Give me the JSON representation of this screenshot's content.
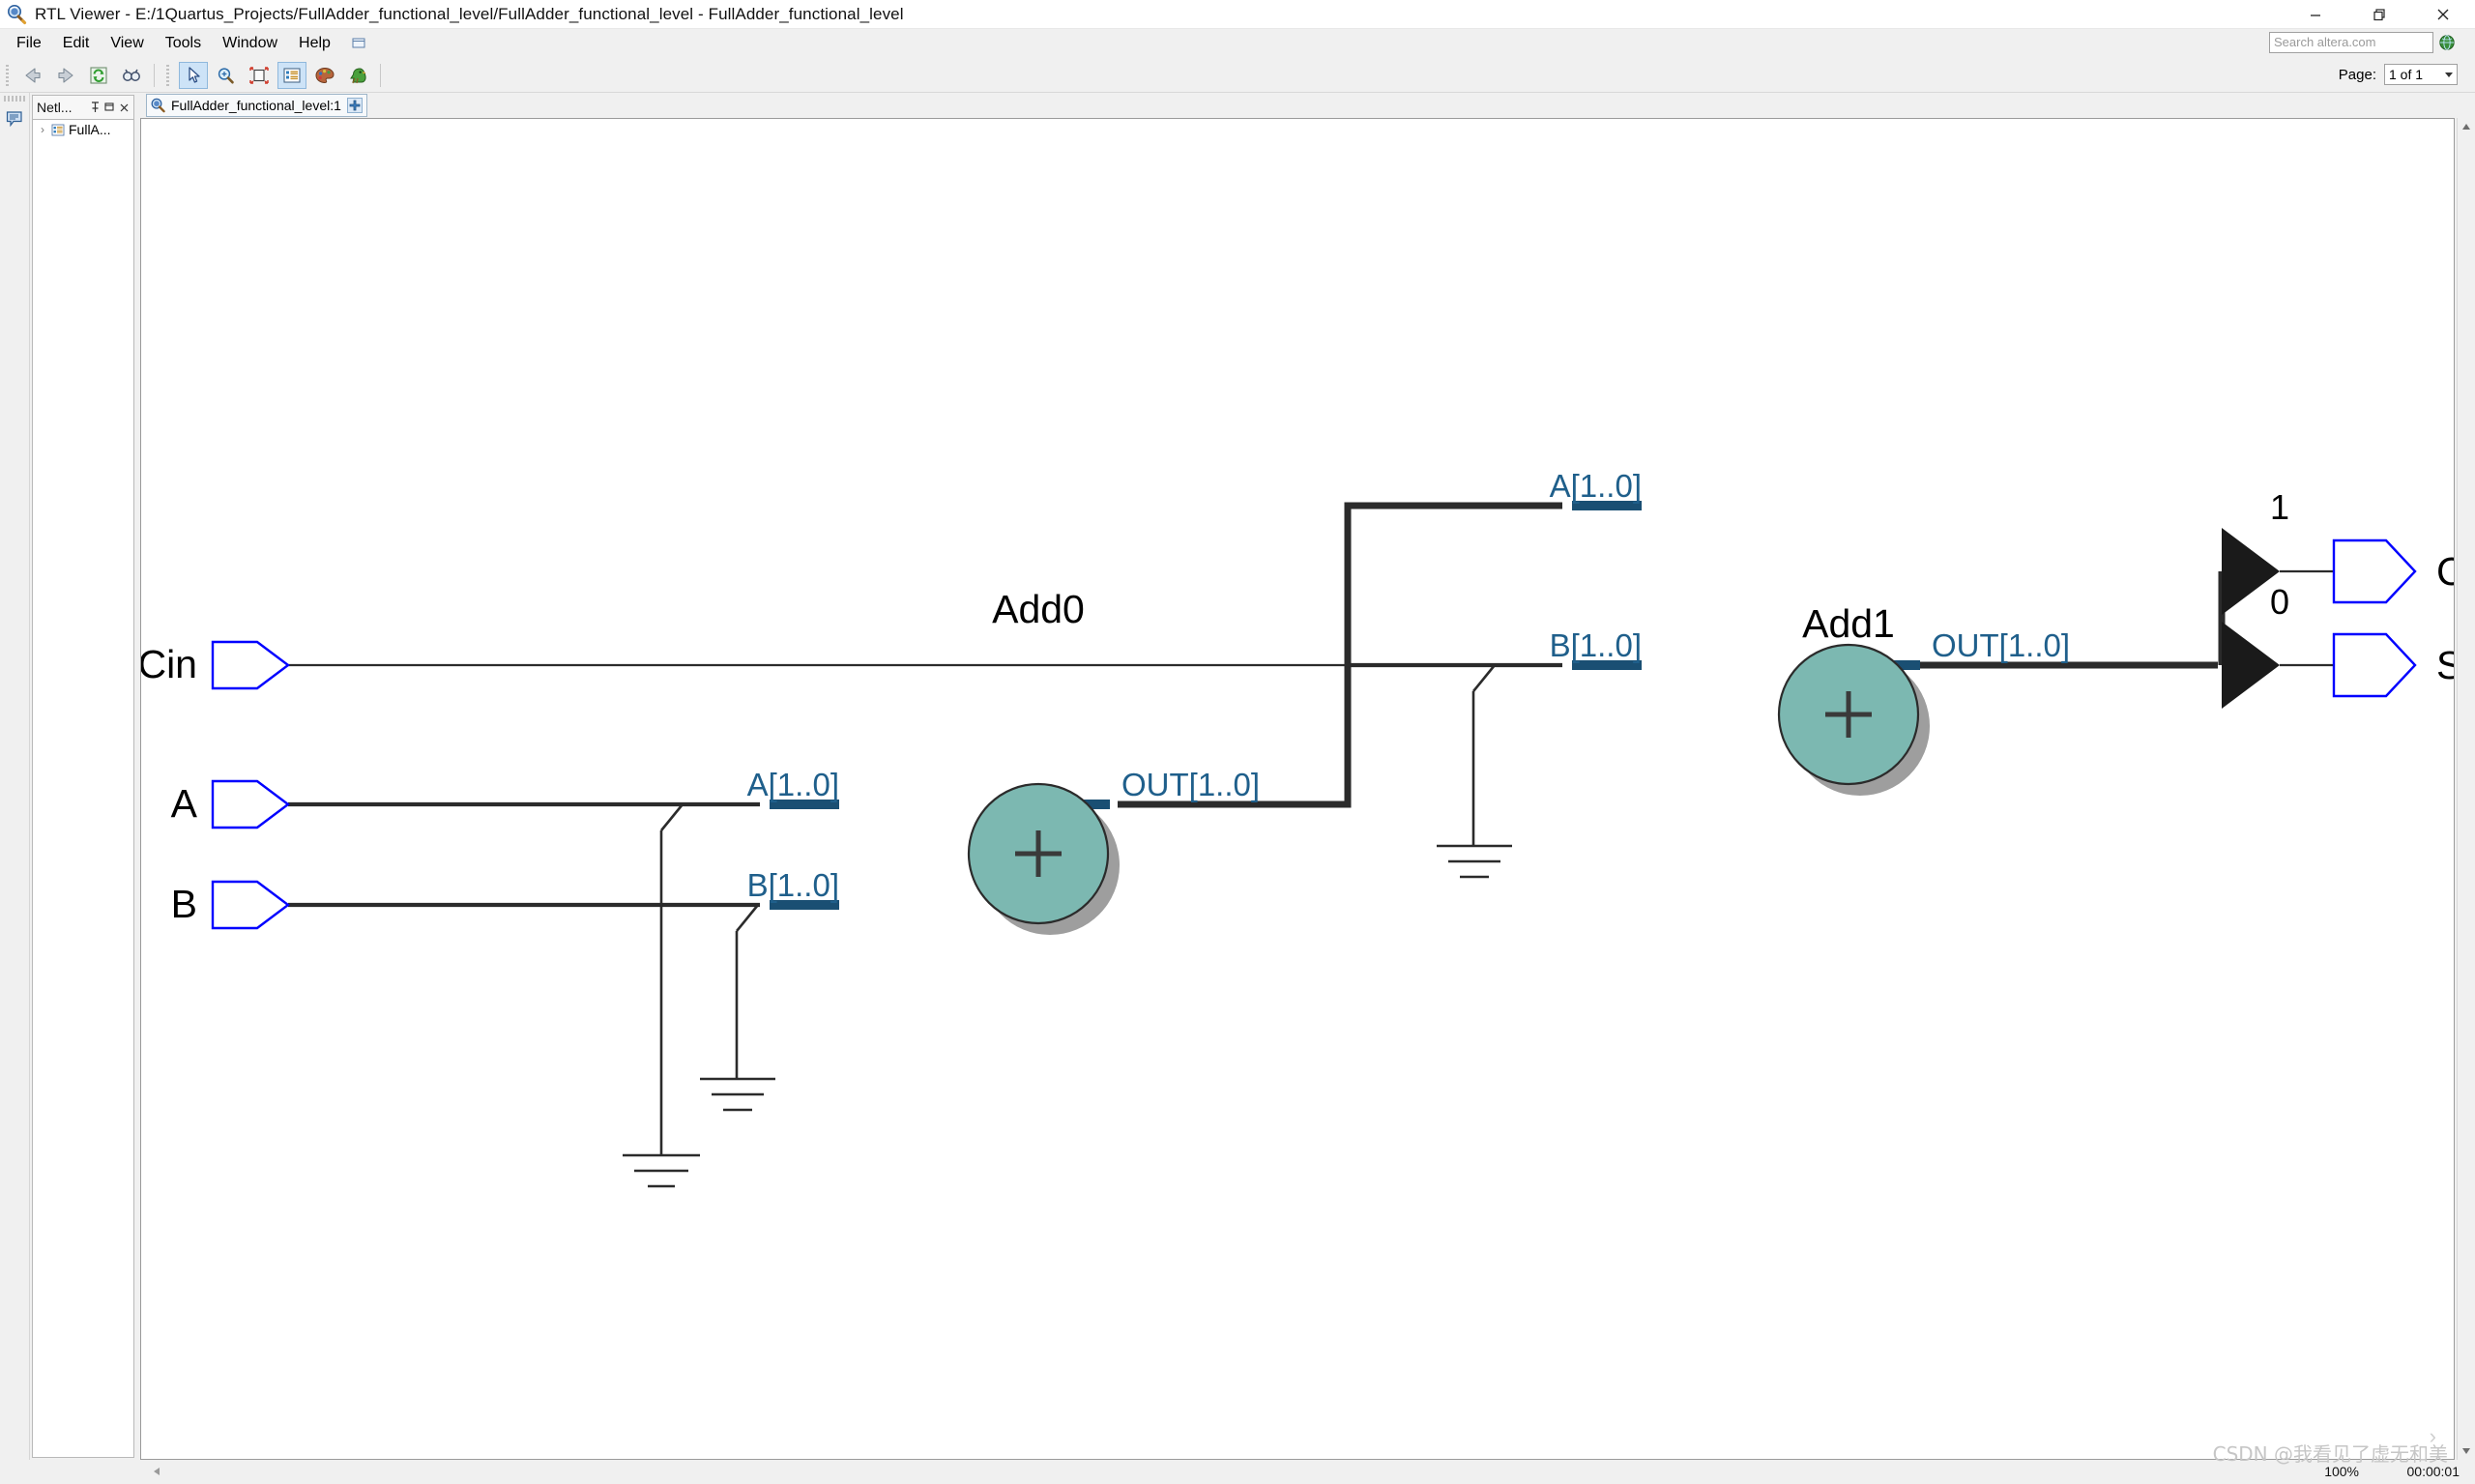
{
  "window": {
    "title": "RTL Viewer - E:/1Quartus_Projects/FullAdder_functional_level/FullAdder_functional_level - FullAdder_functional_level",
    "icon": "rtl-viewer-icon",
    "controls": {
      "minimize": "—",
      "restore": "❐",
      "close": "✕"
    }
  },
  "menu": {
    "items": [
      {
        "label": "File"
      },
      {
        "label": "Edit"
      },
      {
        "label": "View"
      },
      {
        "label": "Tools"
      },
      {
        "label": "Window"
      },
      {
        "label": "Help"
      }
    ],
    "extra_icon": "window-list-icon"
  },
  "search": {
    "placeholder": "Search altera.com",
    "value": "",
    "globe_icon": "globe-icon"
  },
  "toolbar": {
    "buttons": [
      {
        "name": "back-icon",
        "active": false
      },
      {
        "name": "forward-icon",
        "active": false
      },
      {
        "name": "refresh-icon",
        "active": false
      },
      {
        "name": "find-icon",
        "active": false
      },
      {
        "name": "select-tool-icon",
        "active": true
      },
      {
        "name": "zoom-tool-icon",
        "active": false
      },
      {
        "name": "fit-page-icon",
        "active": false
      },
      {
        "name": "netlist-navigator-icon",
        "active": true
      },
      {
        "name": "color-palette-icon",
        "active": false
      },
      {
        "name": "bird-icon",
        "active": false
      }
    ]
  },
  "page": {
    "label": "Page:",
    "value": "1 of 1"
  },
  "left_strip": {
    "message_icon": "message-window-icon"
  },
  "netlist": {
    "title": "Netl...",
    "pin_icon": "pin-icon",
    "float_icon": "float-icon",
    "close_icon": "close-icon",
    "tree": [
      {
        "arrow": "›",
        "icon": "hierarchy-icon",
        "label": "FullA..."
      }
    ]
  },
  "tab": {
    "icon": "rtl-viewer-icon",
    "label": "FullAdder_functional_level:1",
    "close_glyph": "✚"
  },
  "status": {
    "zoom": "100%",
    "time": "00:00:01",
    "collapse_glyph": "‹",
    "watermark": "CSDN @我看见了虚无和美",
    "watermark_caret": "›"
  },
  "schematic": {
    "colors": {
      "port_outline": "#0000ff",
      "label_text": "#1f5f8b",
      "block_fill": "#7cb8b1",
      "block_stroke": "#2b2b2b",
      "block_shadow": "#9e9e9e",
      "wire": "#2b2b2b",
      "port_stub": "#1a4f73",
      "name_text": "#000000"
    },
    "inputs": [
      {
        "name": "Cin",
        "label": "Cin"
      },
      {
        "name": "A",
        "label": "A"
      },
      {
        "name": "B",
        "label": "B"
      }
    ],
    "outputs": [
      {
        "name": "Cout",
        "label": "Cout",
        "bit": "1"
      },
      {
        "name": "Sum",
        "label": "Sum",
        "bit": "0"
      }
    ],
    "blocks": [
      {
        "name": "Add0",
        "label": "Add0",
        "symbol": "+",
        "ports_in": [
          "A[1..0]",
          "B[1..0]"
        ],
        "ports_out": [
          "OUT[1..0]"
        ]
      },
      {
        "name": "Add1",
        "label": "Add1",
        "symbol": "+",
        "ports_in": [
          "A[1..0]",
          "B[1..0]"
        ],
        "ports_out": [
          "OUT[1..0]"
        ]
      }
    ],
    "grounds": 3
  }
}
